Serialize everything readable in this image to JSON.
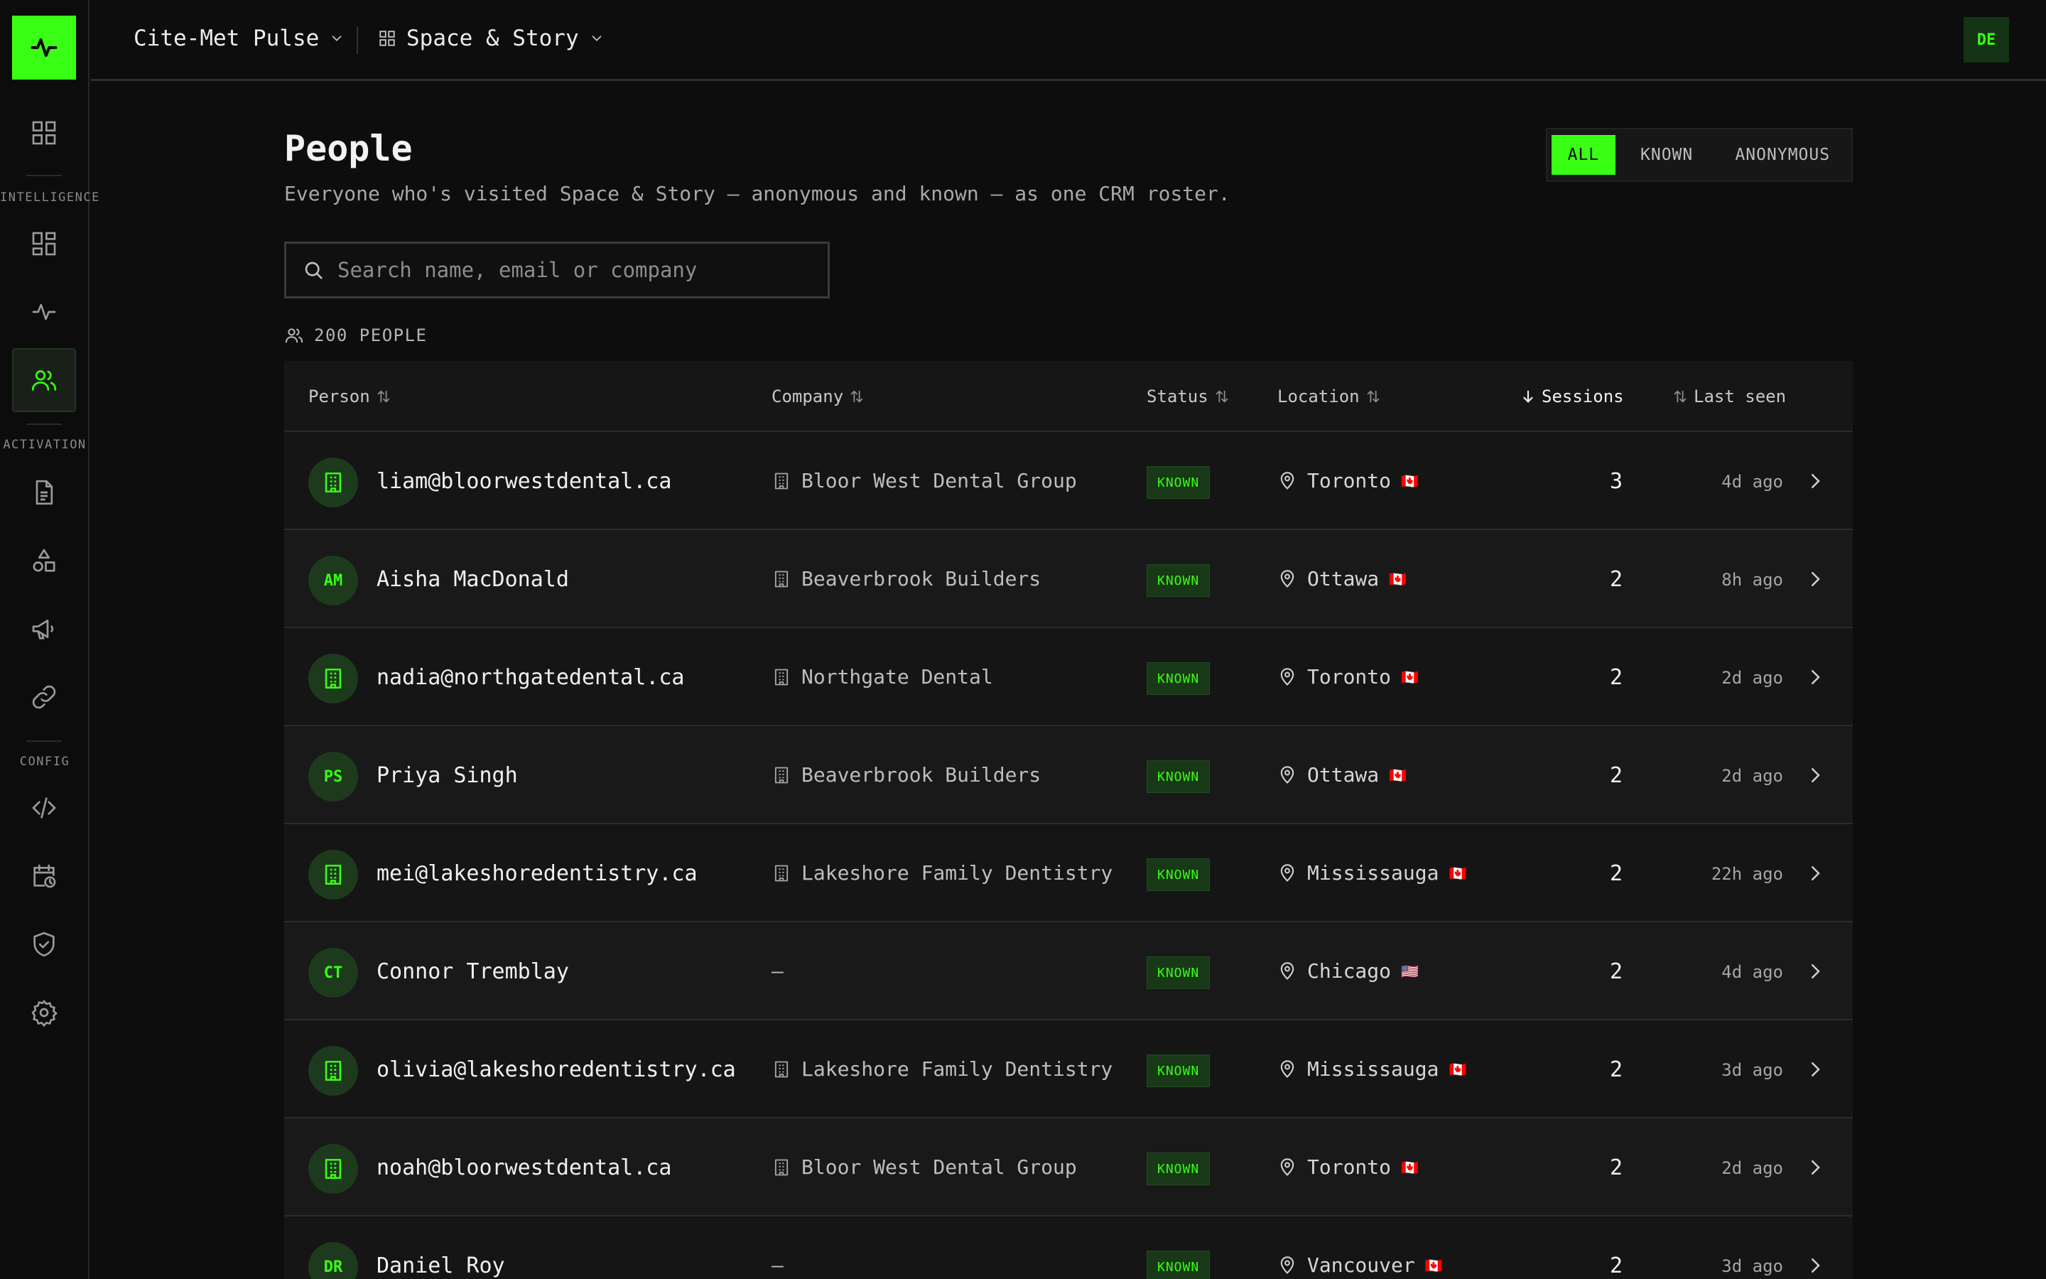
{
  "app": {
    "workspace": "Cite-Met Pulse",
    "project": "Space & Story",
    "user_initials": "DE",
    "accent": "#39ff14"
  },
  "rail": {
    "sections": {
      "intelligence": "INTELLIGENCE",
      "activation": "ACTIVATION",
      "config": "CONFIG"
    },
    "items": [
      {
        "icon": "grid-icon",
        "active": false
      },
      {
        "icon": "dashboard-icon",
        "active": false
      },
      {
        "icon": "pulse-icon",
        "active": false
      },
      {
        "icon": "people-icon",
        "active": true
      },
      {
        "icon": "document-icon",
        "active": false
      },
      {
        "icon": "shapes-icon",
        "active": false
      },
      {
        "icon": "megaphone-icon",
        "active": false
      },
      {
        "icon": "link-icon",
        "active": false
      },
      {
        "icon": "code-icon",
        "active": false
      },
      {
        "icon": "calendar-clock-icon",
        "active": false
      },
      {
        "icon": "shield-check-icon",
        "active": false
      },
      {
        "icon": "gear-icon",
        "active": false
      }
    ]
  },
  "page": {
    "title": "People",
    "subtitle": "Everyone who's visited Space & Story — anonymous and known — as one CRM roster.",
    "filters": [
      "ALL",
      "KNOWN",
      "ANONYMOUS"
    ],
    "active_filter": "ALL",
    "search_placeholder": "Search name, email or company",
    "count_label": "200 PEOPLE"
  },
  "table": {
    "columns": {
      "person": "Person",
      "company": "Company",
      "status": "Status",
      "location": "Location",
      "sessions": "Sessions",
      "last_seen": "Last seen"
    },
    "sorted_column": "Sessions",
    "rows": [
      {
        "avatar": "building-icon",
        "initials": "",
        "person": "liam@bloorwestdental.ca",
        "company": "Bloor West Dental Group",
        "status": "KNOWN",
        "location": "Toronto",
        "flag": "🇨🇦",
        "sessions": "3",
        "last_seen": "4d ago"
      },
      {
        "avatar": "initials",
        "initials": "AM",
        "person": "Aisha MacDonald",
        "company": "Beaverbrook Builders",
        "status": "KNOWN",
        "location": "Ottawa",
        "flag": "🇨🇦",
        "sessions": "2",
        "last_seen": "8h ago"
      },
      {
        "avatar": "building-icon",
        "initials": "",
        "person": "nadia@northgatedental.ca",
        "company": "Northgate Dental",
        "status": "KNOWN",
        "location": "Toronto",
        "flag": "🇨🇦",
        "sessions": "2",
        "last_seen": "2d ago"
      },
      {
        "avatar": "initials",
        "initials": "PS",
        "person": "Priya Singh",
        "company": "Beaverbrook Builders",
        "status": "KNOWN",
        "location": "Ottawa",
        "flag": "🇨🇦",
        "sessions": "2",
        "last_seen": "2d ago"
      },
      {
        "avatar": "building-icon",
        "initials": "",
        "person": "mei@lakeshoredentistry.ca",
        "company": "Lakeshore Family Dentistry",
        "status": "KNOWN",
        "location": "Mississauga",
        "flag": "🇨🇦",
        "sessions": "2",
        "last_seen": "22h ago"
      },
      {
        "avatar": "initials",
        "initials": "CT",
        "person": "Connor Tremblay",
        "company": "—",
        "status": "KNOWN",
        "location": "Chicago",
        "flag": "🇺🇸",
        "sessions": "2",
        "last_seen": "4d ago"
      },
      {
        "avatar": "building-icon",
        "initials": "",
        "person": "olivia@lakeshoredentistry.ca",
        "company": "Lakeshore Family Dentistry",
        "status": "KNOWN",
        "location": "Mississauga",
        "flag": "🇨🇦",
        "sessions": "2",
        "last_seen": "3d ago"
      },
      {
        "avatar": "building-icon",
        "initials": "",
        "person": "noah@bloorwestdental.ca",
        "company": "Bloor West Dental Group",
        "status": "KNOWN",
        "location": "Toronto",
        "flag": "🇨🇦",
        "sessions": "2",
        "last_seen": "2d ago"
      },
      {
        "avatar": "initials",
        "initials": "DR",
        "person": "Daniel Roy",
        "company": "—",
        "status": "KNOWN",
        "location": "Vancouver",
        "flag": "🇨🇦",
        "sessions": "2",
        "last_seen": "3d ago"
      }
    ]
  }
}
